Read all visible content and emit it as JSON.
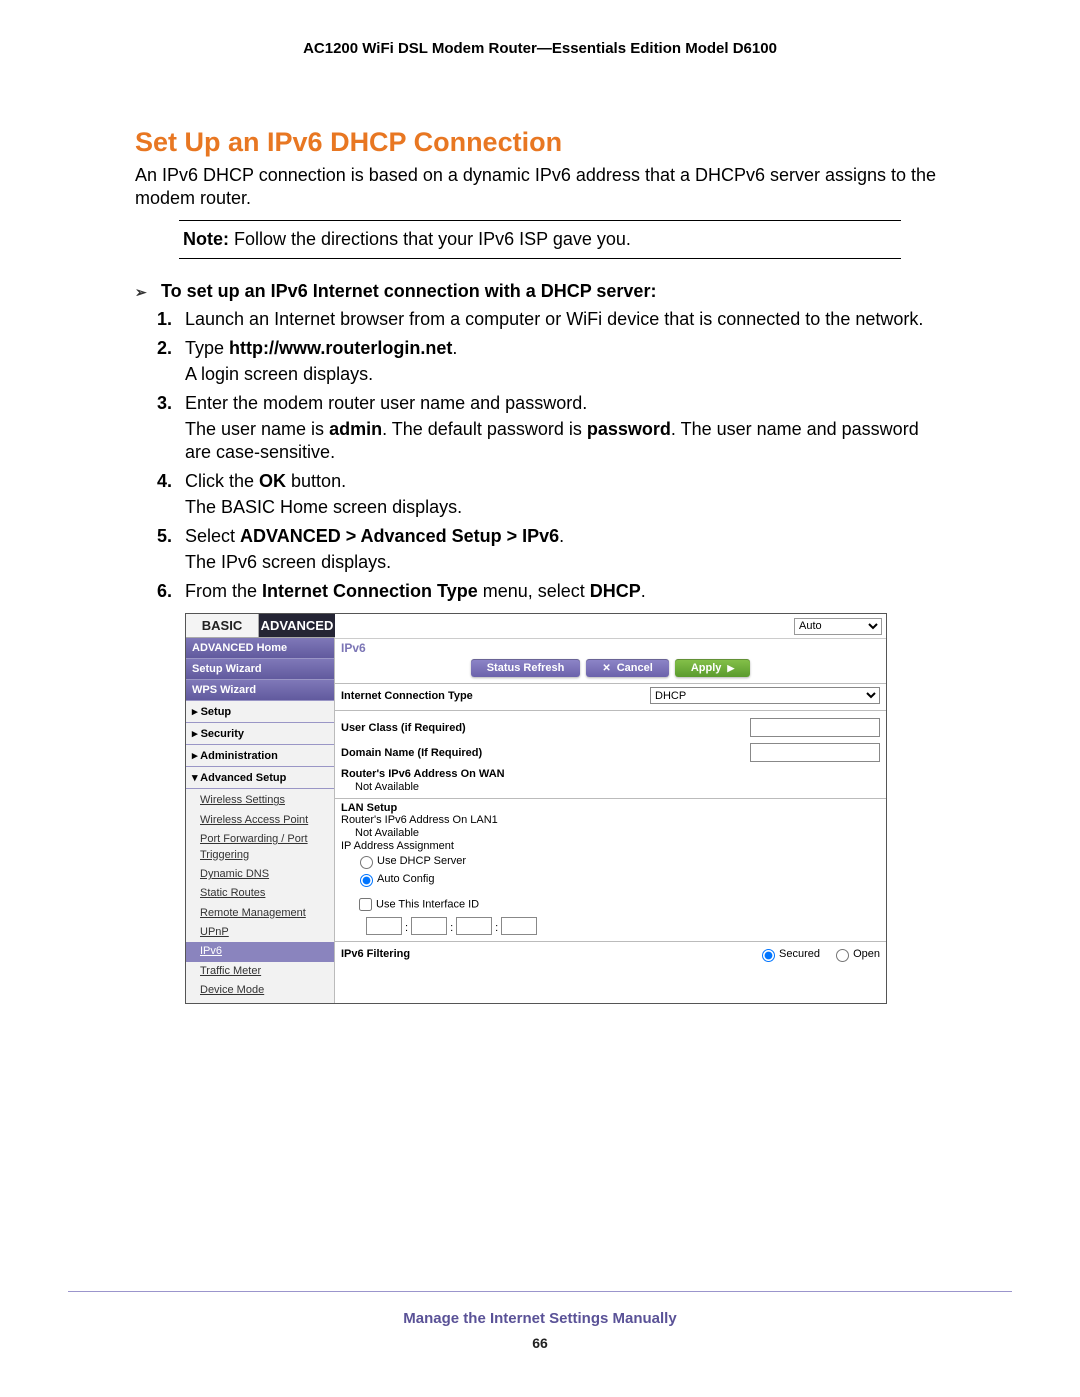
{
  "header": {
    "title": "AC1200 WiFi DSL Modem Router—Essentials Edition Model D6100"
  },
  "section": {
    "heading": "Set Up an IPv6 DHCP Connection",
    "intro": "An IPv6 DHCP connection is based on a dynamic IPv6 address that a DHCPv6 server assigns to the modem router.",
    "note_label": "Note:",
    "note_text": " Follow the directions that your IPv6 ISP gave you.",
    "proc_heading": "To set up an IPv6 Internet connection with a DHCP server:"
  },
  "steps": {
    "s1": {
      "num": "1.",
      "text": "Launch an Internet browser from a computer or WiFi device that is connected to the network."
    },
    "s2": {
      "num": "2.",
      "pre": "Type ",
      "bold": "http://www.routerlogin.net",
      "post": ".",
      "sub": "A login screen displays."
    },
    "s3": {
      "num": "3.",
      "text": "Enter the modem router user name and password.",
      "sub_pre": "The user name is ",
      "sub_b1": "admin",
      "sub_mid": ". The default password is ",
      "sub_b2": "password",
      "sub_post": ". The user name and password are case-sensitive."
    },
    "s4": {
      "num": "4.",
      "pre": "Click the ",
      "bold": "OK",
      "post": " button.",
      "sub": "The BASIC Home screen displays."
    },
    "s5": {
      "num": "5.",
      "pre": "Select ",
      "bold": "ADVANCED > Advanced Setup > IPv6",
      "post": ".",
      "sub": "The IPv6 screen displays."
    },
    "s6": {
      "num": "6.",
      "pre": "From the ",
      "bold": "Internet Connection Type",
      "mid": " menu, select ",
      "bold2": "DHCP",
      "post": "."
    }
  },
  "mock": {
    "tabs": {
      "basic": "BASIC",
      "advanced": "ADVANCED"
    },
    "sidebar": {
      "home": "ADVANCED Home",
      "wizard": "Setup Wizard",
      "wps": "WPS Wizard",
      "setup": "▸ Setup",
      "security": "▸ Security",
      "admin": "▸ Administration",
      "advsetup": "▾ Advanced Setup",
      "subs": {
        "wireless": "Wireless Settings",
        "wap": "Wireless Access Point",
        "portfwd": "Port Forwarding / Port Triggering",
        "ddns": "Dynamic DNS",
        "sroutes": "Static Routes",
        "remote": "Remote Management",
        "upnp": "UPnP",
        "ipv6": "IPv6",
        "traffic": "Traffic Meter",
        "device": "Device Mode"
      }
    },
    "top_select": "Auto",
    "title": "IPv6",
    "buttons": {
      "refresh": "Status Refresh",
      "cancel": "Cancel",
      "apply": "Apply"
    },
    "form": {
      "conntype_lbl": "Internet Connection Type",
      "conntype_val": "DHCP",
      "userclass": "User Class (if Required)",
      "domain": "Domain Name  (If Required)",
      "wanaddr": "Router's IPv6 Address On WAN",
      "na": "Not Available",
      "lansetup": "LAN Setup",
      "lanaddr": "Router's IPv6 Address On LAN1",
      "ipassign": "IP Address Assignment",
      "usedhcp": "Use DHCP Server",
      "autocfg": "Auto Config",
      "useiface": "Use This Interface ID",
      "filter_lbl": "IPv6 Filtering",
      "secured": "Secured",
      "open": "Open"
    }
  },
  "footer": {
    "title": "Manage the Internet Settings Manually",
    "page": "66"
  }
}
